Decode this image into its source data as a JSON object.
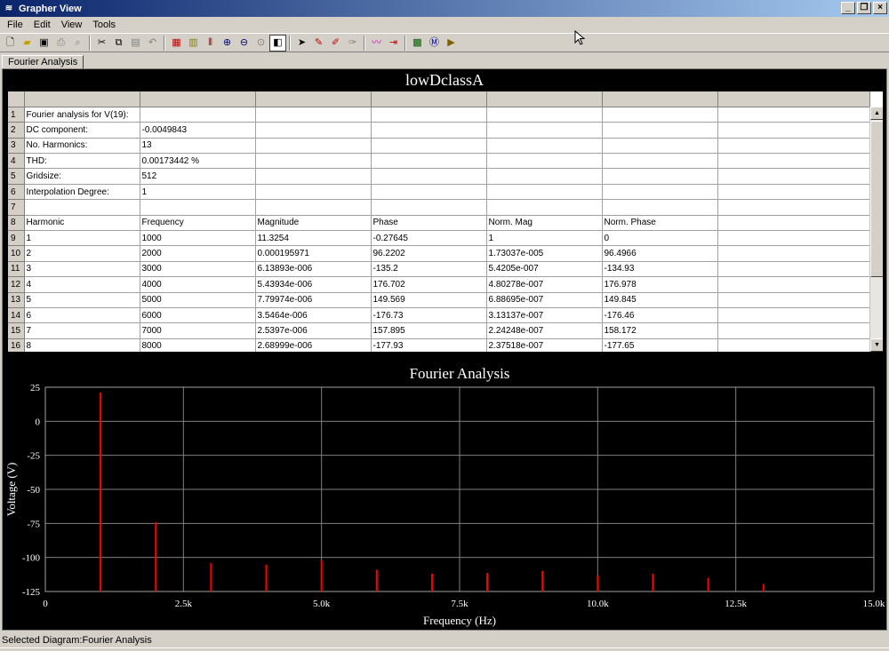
{
  "window": {
    "title": "Grapher View"
  },
  "menu": [
    "File",
    "Edit",
    "View",
    "Tools"
  ],
  "toolbar_icons": [
    "new-icon",
    "open-icon",
    "save-icon",
    "print-icon",
    "print-preview-icon",
    "cut-icon",
    "copy-icon",
    "paste-icon",
    "undo-icon",
    "grid-icon",
    "cursor-icon",
    "bar-icon",
    "zoom-in-icon",
    "zoom-out-icon",
    "zoom-fit-icon",
    "reverse-colors-icon",
    "select-marker-icon",
    "select-trace-icon",
    "toggle-marker-icon",
    "delete-marker-icon",
    "add-marker-icon",
    "export-icon",
    "excel-icon",
    "mathcad-icon",
    "overlay-icon"
  ],
  "tabs": [
    {
      "label": "Fourier Analysis"
    }
  ],
  "table": {
    "title": "lowDclassA",
    "rows": [
      [
        "Fourier analysis for V(19):",
        "",
        "",
        "",
        "",
        ""
      ],
      [
        "DC component:",
        "-0.0049843",
        "",
        "",
        "",
        ""
      ],
      [
        "No. Harmonics:",
        "13",
        "",
        "",
        "",
        ""
      ],
      [
        "THD:",
        "0.00173442 %",
        "",
        "",
        "",
        ""
      ],
      [
        "Gridsize:",
        "512",
        "",
        "",
        "",
        ""
      ],
      [
        "Interpolation Degree:",
        "1",
        "",
        "",
        "",
        ""
      ],
      [
        "",
        "",
        "",
        "",
        "",
        ""
      ],
      [
        "Harmonic",
        "Frequency",
        "Magnitude",
        "Phase",
        "Norm. Mag",
        "Norm. Phase"
      ],
      [
        "1",
        "1000",
        "11.3254",
        "-0.27645",
        "1",
        "0"
      ],
      [
        "2",
        "2000",
        "0.000195971",
        "96.2202",
        "1.73037e-005",
        "96.4966"
      ],
      [
        "3",
        "3000",
        "6.13893e-006",
        "-135.2",
        "5.4205e-007",
        "-134.93"
      ],
      [
        "4",
        "4000",
        "5.43934e-006",
        "176.702",
        "4.80278e-007",
        "176.978"
      ],
      [
        "5",
        "5000",
        "7.79974e-006",
        "149.569",
        "6.88695e-007",
        "149.845"
      ],
      [
        "6",
        "6000",
        "3.5464e-006",
        "-176.73",
        "3.13137e-007",
        "-176.46"
      ],
      [
        "7",
        "7000",
        "2.5397e-006",
        "157.895",
        "2.24248e-007",
        "158.172"
      ],
      [
        "8",
        "8000",
        "2.68999e-006",
        "-177.93",
        "2.37518e-007",
        "-177.65"
      ]
    ]
  },
  "chart_data": {
    "type": "bar",
    "title": "Fourier Analysis",
    "xlabel": "Frequency (Hz)",
    "ylabel": "Voltage (V)",
    "xlim": [
      0,
      15000
    ],
    "ylim": [
      -125,
      25
    ],
    "x_ticks": [
      0,
      2500,
      5000,
      7500,
      10000,
      12500,
      15000
    ],
    "x_tick_labels": [
      "0",
      "2.5k",
      "5.0k",
      "7.5k",
      "10.0k",
      "12.5k",
      "15.0k"
    ],
    "y_ticks": [
      25,
      0,
      -25,
      -50,
      -75,
      -100,
      -125
    ],
    "y_tick_labels": [
      "25",
      "0",
      "-25",
      "-50",
      "-75",
      "-100",
      "-125"
    ],
    "grid": true,
    "series": [
      {
        "color": "#ff0000",
        "x": [
          1000,
          2000,
          3000,
          4000,
          5000,
          6000,
          7000,
          8000,
          9000,
          10000,
          11000,
          12000,
          13000
        ],
        "values": [
          21.1,
          -74.2,
          -104.2,
          -105.3,
          -102.2,
          -109.0,
          -111.9,
          -111.4,
          -109.9,
          -113.2,
          -112.0,
          -115.0,
          -119.5
        ]
      }
    ]
  },
  "status": {
    "text": "Selected Diagram:Fourier Analysis"
  }
}
